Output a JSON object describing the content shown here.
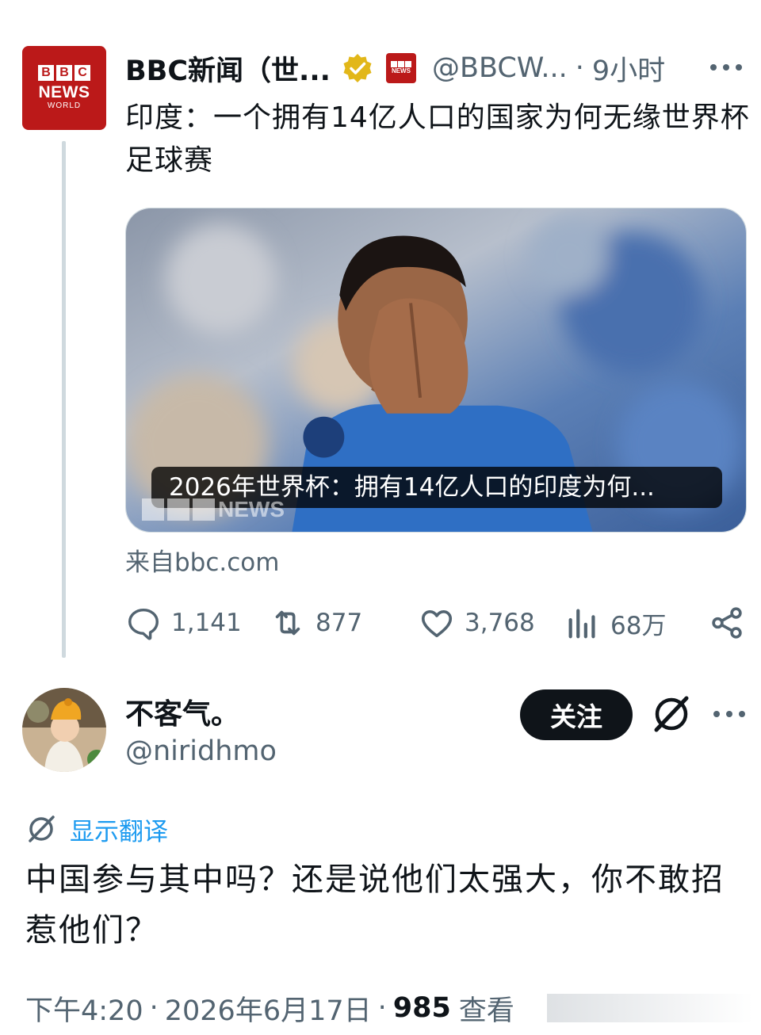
{
  "post": {
    "avatar_logo": {
      "blocks": [
        "B",
        "B",
        "C"
      ],
      "line1": "NEWS",
      "line2": "WORLD"
    },
    "display_name": "BBC新闻（世...",
    "handle": "@BBCW...",
    "separator": "·",
    "time_ago": "9小时",
    "text": "印度：一个拥有14亿人口的国家为何无缘世界杯足球赛",
    "card": {
      "caption": "2026年世界杯：拥有14亿人口的印度为何...",
      "watermark": "NEWS",
      "source": "来自bbc.com"
    },
    "stats": {
      "replies": "1,141",
      "reposts": "877",
      "likes": "3,768",
      "views": "68万"
    }
  },
  "reply": {
    "display_name": "不客气。",
    "handle": "@niridhmo",
    "follow_label": "关注",
    "translate_label": "显示翻译",
    "text": "中国参与其中吗？还是说他们太强大，你不敢招惹他们？",
    "meta": {
      "time": "下午4:20",
      "sep1": "·",
      "date": "2026年6月17日",
      "sep2": "·",
      "views_count": "985",
      "views_label": "查看"
    }
  },
  "colors": {
    "bbc_red": "#bb1919",
    "secondary_text": "#536471",
    "link_blue": "#1d9bf0",
    "verified_gold": "#e2b719",
    "follow_bg": "#0f1419"
  }
}
